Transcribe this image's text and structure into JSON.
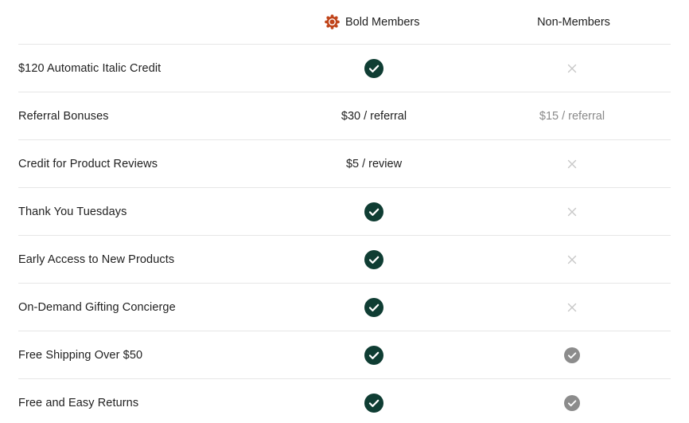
{
  "colors": {
    "check_green": "#0f3d33",
    "check_gray": "#8c8c8c",
    "x_gray": "#c8c8c8",
    "badge_orange": "#c0451b",
    "divider": "#e6e6e6"
  },
  "header": {
    "bold_members_label": "Bold Members",
    "bold_members_icon": "bold-badge-icon",
    "non_members_label": "Non-Members"
  },
  "rows": [
    {
      "label": "$120 Automatic Italic Credit",
      "bold": {
        "type": "check"
      },
      "non": {
        "type": "x"
      }
    },
    {
      "label": "Referral Bonuses",
      "bold": {
        "type": "text",
        "text": "$30 / referral"
      },
      "non": {
        "type": "text",
        "text": "$15 / referral"
      }
    },
    {
      "label": "Credit for Product Reviews",
      "bold": {
        "type": "text",
        "text": "$5 / review"
      },
      "non": {
        "type": "x"
      }
    },
    {
      "label": "Thank You Tuesdays",
      "bold": {
        "type": "check"
      },
      "non": {
        "type": "x"
      }
    },
    {
      "label": "Early Access to New Products",
      "bold": {
        "type": "check"
      },
      "non": {
        "type": "x"
      }
    },
    {
      "label": "On-Demand Gifting Concierge",
      "bold": {
        "type": "check"
      },
      "non": {
        "type": "x"
      }
    },
    {
      "label": "Free Shipping Over $50",
      "bold": {
        "type": "check"
      },
      "non": {
        "type": "check-gray"
      }
    },
    {
      "label": "Free and Easy Returns",
      "bold": {
        "type": "check"
      },
      "non": {
        "type": "check-gray"
      }
    }
  ]
}
